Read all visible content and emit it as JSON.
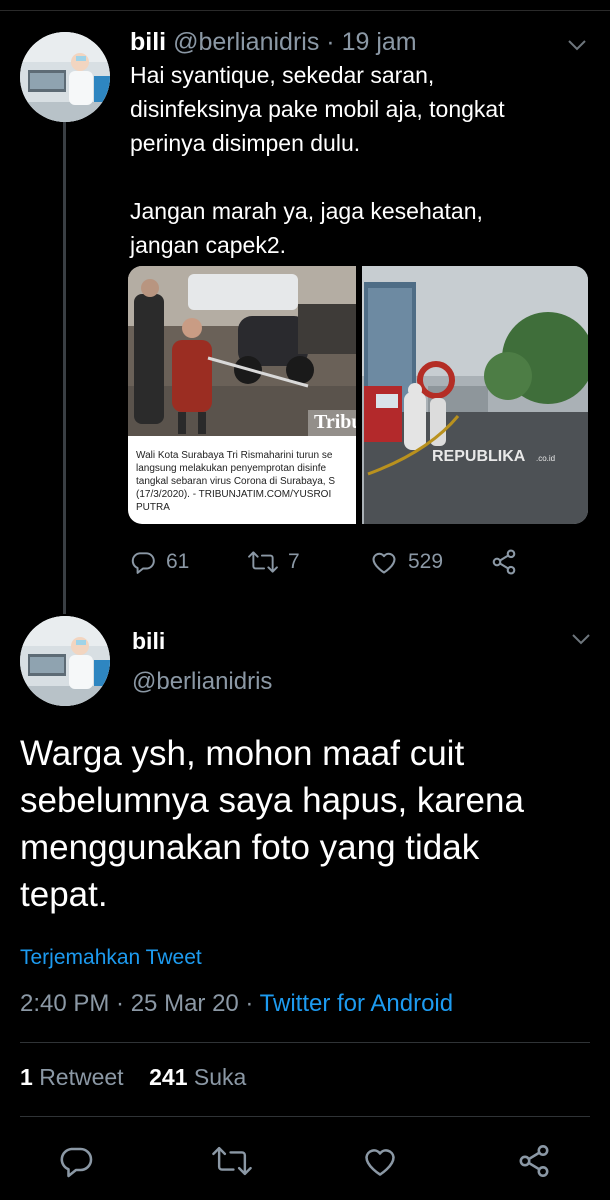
{
  "tweet1": {
    "display_name": "bili",
    "handle": "@berlianidris",
    "time_sep": "·",
    "time": "19 jam",
    "body_lines": [
      "Hai syantique, sekedar saran,",
      "disinfeksinya pake mobil aja, tongkat",
      "perinya disimpen dulu.",
      "",
      "Jangan marah ya, jaga kesehatan,",
      "jangan capek2."
    ],
    "media": {
      "left_caption_lines": [
        "Wali Kota Surabaya Tri Rismaharini turun se",
        "langsung melakukan penyemprotan disinfe",
        "tangkal sebaran virus Corona di Surabaya, S",
        "(17/3/2020). - TRIBUNJATIM.COM/YUSROI",
        "PUTRA"
      ],
      "left_watermark": "Tribun",
      "right_watermark": "REPUBLIKA",
      "right_watermark_suffix": ".co.id"
    },
    "actions": {
      "replies": "61",
      "retweets": "7",
      "likes": "529"
    }
  },
  "tweet2": {
    "display_name": "bili",
    "handle": "@berlianidris",
    "body_lines": [
      "Warga ysh, mohon maaf cuit",
      "sebelumnya saya hapus, karena",
      "menggunakan foto yang tidak",
      "tepat."
    ],
    "translate_label": "Terjemahkan Tweet",
    "timestamp": "2:40 PM · 25 Mar 20 · ",
    "source": "Twitter for Android",
    "stats": {
      "retweet_count": "1",
      "retweet_label": "Retweet",
      "like_count": "241",
      "like_label": "Suka"
    }
  },
  "colors": {
    "background": "#000000",
    "muted": "#8b98a5",
    "link": "#1d9bf0"
  },
  "icons": [
    "chevron-down-icon",
    "reply-icon",
    "retweet-icon",
    "like-icon",
    "share-icon"
  ]
}
